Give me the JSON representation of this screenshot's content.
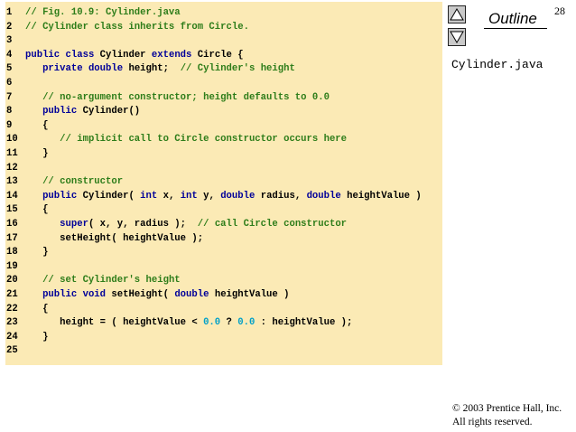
{
  "page_number": "28",
  "outline": {
    "title": "Outline",
    "file_name": "Cylinder.java",
    "up_button": "up-arrow-icon",
    "down_button": "down-arrow-icon"
  },
  "code_lines": [
    {
      "num": "1",
      "tokens": [
        {
          "t": "// Fig. 10.9: Cylinder.java",
          "k": "comment"
        }
      ]
    },
    {
      "num": "2",
      "tokens": [
        {
          "t": "// Cylinder class inherits from Circle.",
          "k": "comment"
        }
      ]
    },
    {
      "num": "3",
      "tokens": []
    },
    {
      "num": "4",
      "tokens": [
        {
          "t": "public",
          "k": "keyword"
        },
        {
          "t": " ",
          "k": "normal"
        },
        {
          "t": "class",
          "k": "keyword"
        },
        {
          "t": " Cylinder ",
          "k": "normal"
        },
        {
          "t": "extends",
          "k": "keyword"
        },
        {
          "t": " Circle {",
          "k": "normal"
        }
      ]
    },
    {
      "num": "5",
      "tokens": [
        {
          "t": "   ",
          "k": "normal"
        },
        {
          "t": "private",
          "k": "keyword"
        },
        {
          "t": " ",
          "k": "normal"
        },
        {
          "t": "double",
          "k": "keyword"
        },
        {
          "t": " height;  ",
          "k": "normal"
        },
        {
          "t": "// Cylinder's height",
          "k": "comment"
        }
      ]
    },
    {
      "num": "6",
      "tokens": []
    },
    {
      "num": "7",
      "tokens": [
        {
          "t": "   ",
          "k": "normal"
        },
        {
          "t": "// no-argument constructor; height defaults to 0.0",
          "k": "comment"
        }
      ]
    },
    {
      "num": "8",
      "tokens": [
        {
          "t": "   ",
          "k": "normal"
        },
        {
          "t": "public",
          "k": "keyword"
        },
        {
          "t": " Cylinder()",
          "k": "normal"
        }
      ]
    },
    {
      "num": "9",
      "tokens": [
        {
          "t": "   {",
          "k": "normal"
        }
      ]
    },
    {
      "num": "10",
      "tokens": [
        {
          "t": "      ",
          "k": "normal"
        },
        {
          "t": "// implicit call to Circle constructor occurs here",
          "k": "comment"
        }
      ]
    },
    {
      "num": "11",
      "tokens": [
        {
          "t": "   }",
          "k": "normal"
        }
      ]
    },
    {
      "num": "12",
      "tokens": []
    },
    {
      "num": "13",
      "tokens": [
        {
          "t": "   ",
          "k": "normal"
        },
        {
          "t": "// constructor",
          "k": "comment"
        }
      ]
    },
    {
      "num": "14",
      "tokens": [
        {
          "t": "   ",
          "k": "normal"
        },
        {
          "t": "public",
          "k": "keyword"
        },
        {
          "t": " Cylinder( ",
          "k": "normal"
        },
        {
          "t": "int",
          "k": "keyword"
        },
        {
          "t": " x, ",
          "k": "normal"
        },
        {
          "t": "int",
          "k": "keyword"
        },
        {
          "t": " y, ",
          "k": "normal"
        },
        {
          "t": "double",
          "k": "keyword"
        },
        {
          "t": " radius, ",
          "k": "normal"
        },
        {
          "t": "double",
          "k": "keyword"
        },
        {
          "t": " heightValue )",
          "k": "normal"
        }
      ]
    },
    {
      "num": "15",
      "tokens": [
        {
          "t": "   {",
          "k": "normal"
        }
      ]
    },
    {
      "num": "16",
      "tokens": [
        {
          "t": "      ",
          "k": "normal"
        },
        {
          "t": "super",
          "k": "keyword"
        },
        {
          "t": "( x, y, radius );  ",
          "k": "normal"
        },
        {
          "t": "// call Circle constructor",
          "k": "comment"
        }
      ]
    },
    {
      "num": "17",
      "tokens": [
        {
          "t": "      setHeight( heightValue );",
          "k": "normal"
        }
      ]
    },
    {
      "num": "18",
      "tokens": [
        {
          "t": "   }",
          "k": "normal"
        }
      ]
    },
    {
      "num": "19",
      "tokens": []
    },
    {
      "num": "20",
      "tokens": [
        {
          "t": "   ",
          "k": "normal"
        },
        {
          "t": "// set Cylinder's height",
          "k": "comment"
        }
      ]
    },
    {
      "num": "21",
      "tokens": [
        {
          "t": "   ",
          "k": "normal"
        },
        {
          "t": "public",
          "k": "keyword"
        },
        {
          "t": " ",
          "k": "normal"
        },
        {
          "t": "void",
          "k": "keyword"
        },
        {
          "t": " setHeight( ",
          "k": "normal"
        },
        {
          "t": "double",
          "k": "keyword"
        },
        {
          "t": " heightValue )",
          "k": "normal"
        }
      ]
    },
    {
      "num": "22",
      "tokens": [
        {
          "t": "   {",
          "k": "normal"
        }
      ]
    },
    {
      "num": "23",
      "tokens": [
        {
          "t": "      height = ( heightValue < ",
          "k": "normal"
        },
        {
          "t": "0.0",
          "k": "number"
        },
        {
          "t": " ? ",
          "k": "normal"
        },
        {
          "t": "0.0",
          "k": "number"
        },
        {
          "t": " : heightValue );",
          "k": "normal"
        }
      ]
    },
    {
      "num": "24",
      "tokens": [
        {
          "t": "   }",
          "k": "normal"
        }
      ]
    },
    {
      "num": "25",
      "tokens": []
    }
  ],
  "copyright": {
    "line1": "© 2003 Prentice Hall, Inc.",
    "line2": "All rights reserved."
  },
  "colors": {
    "panel_background": "#fbeab5",
    "keyword": "#000099",
    "comment": "#2e7d1a",
    "number": "#00a0c8",
    "normal": "#000000"
  }
}
